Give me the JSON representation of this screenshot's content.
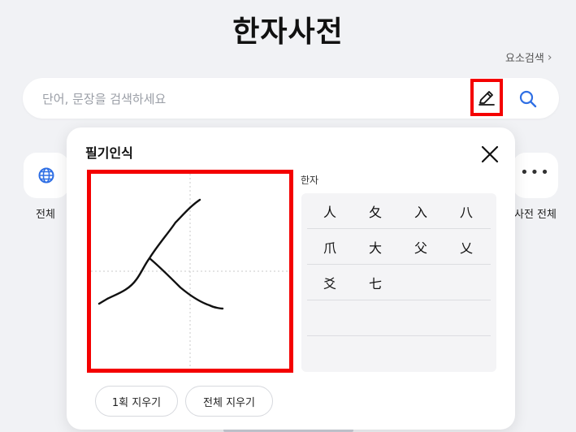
{
  "page": {
    "title": "한자사전"
  },
  "header": {
    "element_search_label": "요소검색"
  },
  "search": {
    "placeholder": "단어, 문장을 검색하세요",
    "value": ""
  },
  "quick_categories": [
    {
      "label": "전체",
      "icon": "globe-icon"
    },
    {
      "label": "사전 전체",
      "icon": "more-dots-icon"
    }
  ],
  "handwriting_modal": {
    "title": "필기인식",
    "result_label": "한자",
    "results": [
      [
        "人",
        "夂",
        "入",
        "八"
      ],
      [
        "爪",
        "大",
        "父",
        "乂"
      ],
      [
        "爻",
        "七"
      ]
    ],
    "buttons": {
      "undo_stroke": "1획 지우기",
      "clear_all": "전체 지우기"
    }
  },
  "colors": {
    "highlight": "#f40000",
    "accent": "#2f6fe4",
    "background": "#f1f2f5"
  }
}
